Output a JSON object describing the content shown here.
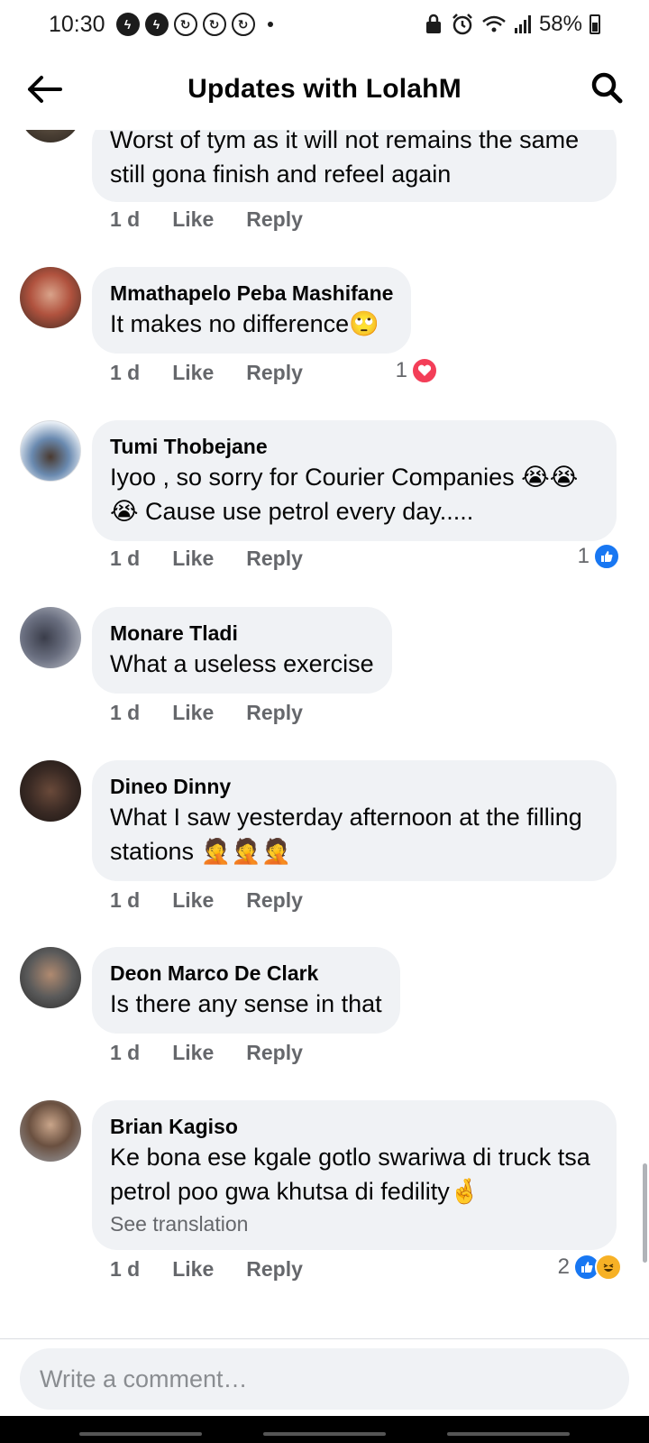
{
  "status_bar": {
    "time": "10:30",
    "battery": "58%"
  },
  "header": {
    "title": "Updates with LolahM"
  },
  "comments": [
    {
      "author": "",
      "text": "Worst of tym as it will not remains the same still gona finish and refeel again",
      "time": "1 d",
      "like": "Like",
      "reply": "Reply",
      "reaction_count": ""
    },
    {
      "author": "Mmathapelo Peba Mashifane",
      "text": "It makes no difference🙄",
      "time": "1 d",
      "like": "Like",
      "reply": "Reply",
      "reaction_count": "1"
    },
    {
      "author": "Tumi Thobejane",
      "text": "Iyoo , so sorry for Courier Companies 😭😭😭 Cause use petrol every day.....",
      "time": "1 d",
      "like": "Like",
      "reply": "Reply",
      "reaction_count": "1"
    },
    {
      "author": "Monare Tladi",
      "text": "What a useless exercise",
      "time": "1 d",
      "like": "Like",
      "reply": "Reply",
      "reaction_count": ""
    },
    {
      "author": "Dineo Dinny",
      "text": "What I saw yesterday afternoon at the filling stations 🤦🤦🤦",
      "time": "1 d",
      "like": "Like",
      "reply": "Reply",
      "reaction_count": ""
    },
    {
      "author": "Deon Marco De Clark",
      "text": "Is there any sense in that",
      "time": "1 d",
      "like": "Like",
      "reply": "Reply",
      "reaction_count": ""
    },
    {
      "author": "Brian Kagiso",
      "text": "Ke bona ese kgale gotlo swariwa di truck tsa petrol poo gwa khutsa di fedility🤞",
      "see_translation": "See translation",
      "time": "1 d",
      "like": "Like",
      "reply": "Reply",
      "reaction_count": "2"
    }
  ],
  "composer": {
    "placeholder": "Write a comment…"
  },
  "colors": {
    "bubble": "#f0f2f5",
    "secondary_text": "#65676b",
    "like_blue": "#1877f2",
    "love_red": "#f33e58",
    "haha_yellow": "#f7b125"
  }
}
